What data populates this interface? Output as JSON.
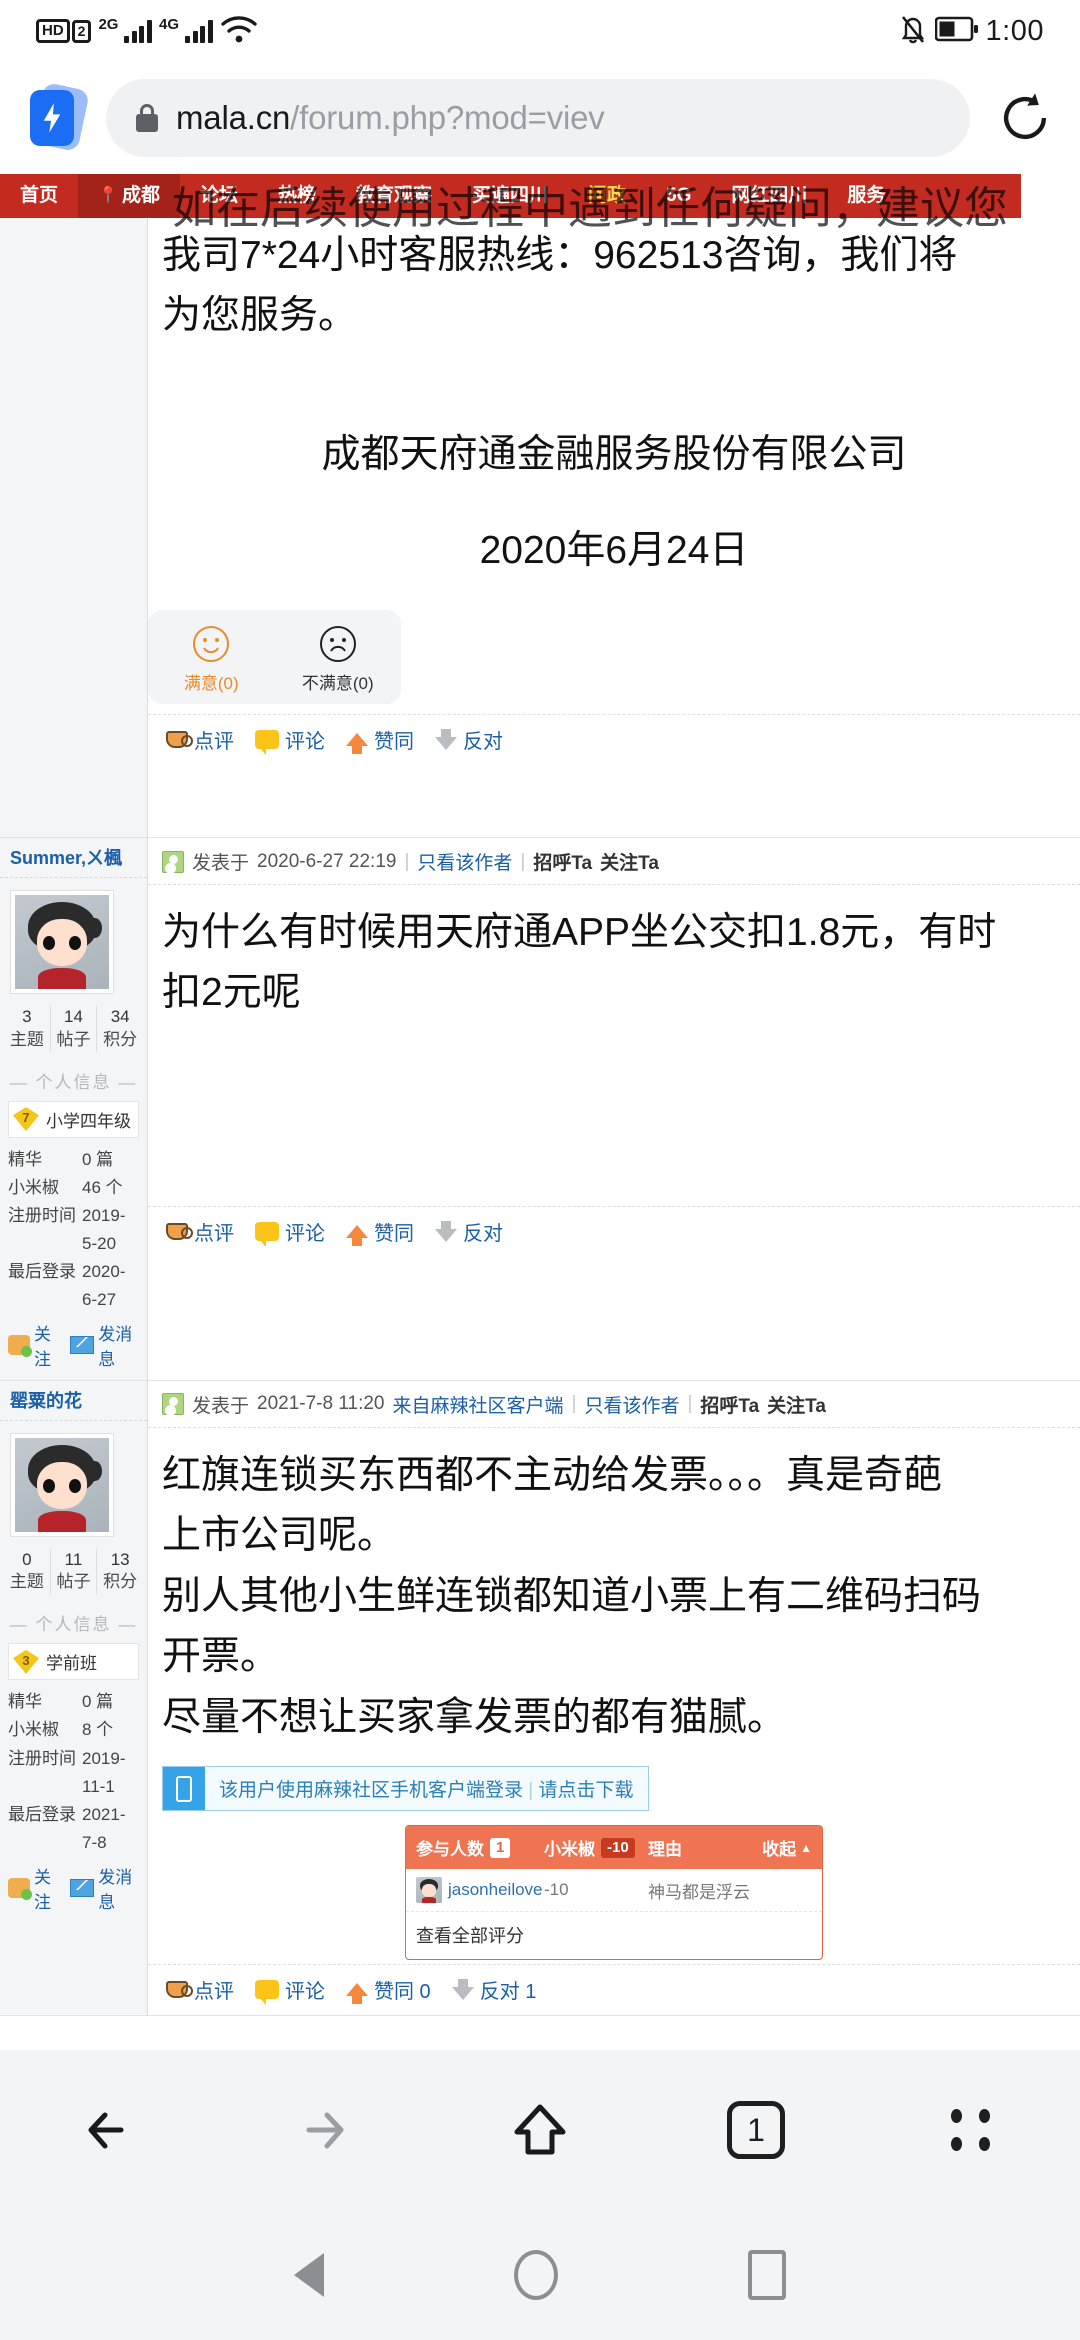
{
  "status_bar": {
    "hd_label": "HD",
    "sim_label": "2",
    "net1": "2G",
    "net2": "4G",
    "wifi_icon": "wifi-icon",
    "mute_icon": "bell-muted-icon",
    "battery_icon": "battery-icon",
    "time": "1:00"
  },
  "browser": {
    "brand_icon": "lightning-badge-icon",
    "lock_icon": "lock-icon",
    "url_main": "mala.cn",
    "url_rest": "/forum.php?mod=viev",
    "reload_icon": "reload-icon",
    "toolbar": {
      "back_icon": "arrow-left-icon",
      "forward_icon": "arrow-right-icon",
      "home_icon": "home-icon",
      "tabs_count": "1",
      "menu_icon": "more-dots-icon"
    }
  },
  "android_nav": {
    "back_icon": "triangle-back-icon",
    "home_icon": "circle-home-icon",
    "recents_icon": "square-recents-icon"
  },
  "site_nav": {
    "items": [
      {
        "label": "首页",
        "highlight": false,
        "city": false
      },
      {
        "label": "成都",
        "highlight": false,
        "city": true
      },
      {
        "label": "论坛",
        "highlight": false,
        "city": false
      },
      {
        "label": "热榜",
        "highlight": false,
        "city": false
      },
      {
        "label": "教育观察",
        "highlight": false,
        "city": false
      },
      {
        "label": "买遍四川",
        "highlight": false,
        "city": false
      },
      {
        "label": "问政",
        "highlight": true,
        "city": false
      },
      {
        "label": "5G",
        "highlight": false,
        "city": false
      },
      {
        "label": "网红四川",
        "highlight": false,
        "city": false
      },
      {
        "label": "服务",
        "highlight": false,
        "city": false
      }
    ],
    "pin_icon": "location-pin-icon",
    "bleed_text": "如在后续使用过程中遇到任何疑问，建议您"
  },
  "posts": [
    {
      "body_lines": [
        "我司7*24小时客服热线：962513咨询，我们将",
        "为您服务。"
      ],
      "signature": "成都天府通金融服务股份有限公司",
      "date": "2020年6月24日",
      "satisfaction": {
        "good_icon": "smile-icon",
        "good_label": "满意(0)",
        "bad_icon": "frown-icon",
        "bad_label": "不满意(0)"
      },
      "actions": [
        {
          "icon": "coffee-cup-icon",
          "label": "点评"
        },
        {
          "icon": "comment-bubble-icon",
          "label": "评论"
        },
        {
          "icon": "thumbs-up-arrow-icon",
          "label": "赞同"
        },
        {
          "icon": "thumbs-down-arrow-icon",
          "label": "反对"
        }
      ]
    },
    {
      "author": "Summer,ㄨ楓",
      "avatar_icon": "user-avatar",
      "head": {
        "user_icon": "user-badge-icon",
        "posted_prefix": "发表于",
        "posted_time": "2020-6-27 22:19",
        "only_author": "只看该作者",
        "greet": "招呼Ta",
        "follow": "关注Ta"
      },
      "body_lines": [
        "为什么有时候用天府通APP坐公交扣1.8元，有时",
        "扣2元呢"
      ],
      "stats": [
        {
          "value": "3",
          "label": "主题"
        },
        {
          "value": "14",
          "label": "帖子"
        },
        {
          "value": "34",
          "label": "积分"
        }
      ],
      "section_title": "个人信息",
      "rank": {
        "level": "7",
        "name": "小学四年级",
        "icon": "medal-icon"
      },
      "info": [
        {
          "key": "精华",
          "value": "0 篇"
        },
        {
          "key": "小米椒",
          "value": "46 个"
        },
        {
          "key": "注册时间",
          "value": "2019-5-20"
        },
        {
          "key": "最后登录",
          "value": "2020-6-27"
        }
      ],
      "side_actions": [
        {
          "icon": "follow-user-icon",
          "label": "关注"
        },
        {
          "icon": "mail-icon",
          "label": "发消息"
        }
      ],
      "actions": [
        {
          "icon": "coffee-cup-icon",
          "label": "点评"
        },
        {
          "icon": "comment-bubble-icon",
          "label": "评论"
        },
        {
          "icon": "thumbs-up-arrow-icon",
          "label": "赞同"
        },
        {
          "icon": "thumbs-down-arrow-icon",
          "label": "反对"
        }
      ]
    },
    {
      "author": "罂粟的花",
      "avatar_icon": "user-avatar",
      "head": {
        "user_icon": "user-badge-icon",
        "posted_prefix": "发表于",
        "posted_time": "2021-7-8 11:20",
        "source": "来自麻辣社区客户端",
        "only_author": "只看该作者",
        "greet": "招呼Ta",
        "follow": "关注Ta"
      },
      "body_lines": [
        "红旗连锁买东西都不主动给发票。。。真是奇葩",
        "上市公司呢。",
        "别人其他小生鲜连锁都知道小票上有二维码扫码",
        "开票。",
        "尽量不想让买家拿发票的都有猫腻。"
      ],
      "stats": [
        {
          "value": "0",
          "label": "主题"
        },
        {
          "value": "11",
          "label": "帖子"
        },
        {
          "value": "13",
          "label": "积分"
        }
      ],
      "section_title": "个人信息",
      "rank": {
        "level": "3",
        "name": "学前班",
        "icon": "medal-icon"
      },
      "info": [
        {
          "key": "精华",
          "value": "0 篇"
        },
        {
          "key": "小米椒",
          "value": "8 个"
        },
        {
          "key": "注册时间",
          "value": "2019-11-1"
        },
        {
          "key": "最后登录",
          "value": "2021-7-8"
        }
      ],
      "side_actions": [
        {
          "icon": "follow-user-icon",
          "label": "关注"
        },
        {
          "icon": "mail-icon",
          "label": "发消息"
        }
      ],
      "client_banner": {
        "phone_icon": "mobile-phone-icon",
        "text": "该用户使用麻辣社区手机客户端登录",
        "divider": "|",
        "link": "请点击下载"
      },
      "rating_table": {
        "header": {
          "participants_label": "参与人数",
          "participants_count": "1",
          "points_label": "小米椒",
          "points_total": "-10",
          "reason_label": "理由",
          "collapse_label": "收起",
          "collapse_icon": "chevron-up-icon"
        },
        "rows": [
          {
            "avatar_icon": "user-avatar",
            "user": "jasonheilove",
            "points": "-10",
            "reason": "神马都是浮云"
          }
        ],
        "footer": "查看全部评分"
      },
      "actions": [
        {
          "icon": "coffee-cup-icon",
          "label": "点评"
        },
        {
          "icon": "comment-bubble-icon",
          "label": "评论"
        },
        {
          "icon": "thumbs-up-arrow-icon",
          "label": "赞同 0"
        },
        {
          "icon": "thumbs-down-arrow-icon",
          "label": "反对 1"
        }
      ]
    }
  ]
}
